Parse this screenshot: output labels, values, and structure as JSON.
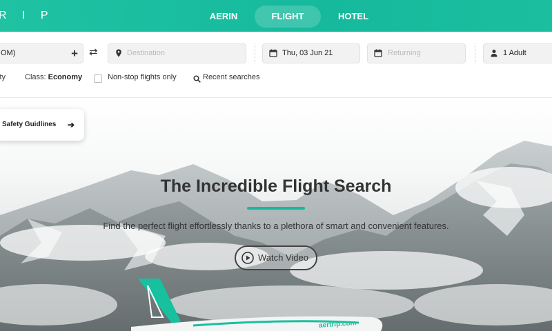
{
  "header": {
    "logo_text": "R I P",
    "tabs": [
      {
        "label": "AERIN",
        "active": false
      },
      {
        "label": "FLIGHT",
        "active": true
      },
      {
        "label": "HOTEL",
        "active": false
      }
    ],
    "accent_color": "#16b99c"
  },
  "search": {
    "origin_value": "OM)",
    "destination_placeholder": "Destination",
    "depart_value": "Thu, 03 Jun 21",
    "return_placeholder": "Returning",
    "passengers_value": "1 Adult",
    "options": {
      "trip_type_partial": "ity",
      "class_label": "Class:",
      "class_value": "Economy",
      "nonstop_label": "Non-stop flights only",
      "nonstop_checked": false,
      "recent_label": "Recent searches"
    }
  },
  "hero": {
    "safety_label": "Safety Guidlines",
    "title": "The Incredible Flight Search",
    "subtitle": "Find the perfect flight effortlessly thanks to a plethora of smart and convenient features.",
    "watch_label": "Watch Video",
    "plane_text": "aertrip.com"
  }
}
